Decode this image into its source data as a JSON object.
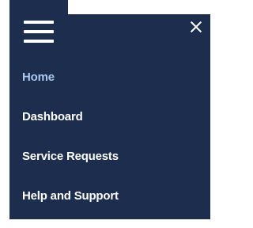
{
  "menu": {
    "background_color": "#1c2d4d",
    "active_color": "#a9c8f0",
    "hamburger_icon": "hamburger-icon",
    "close_icon": "close-icon",
    "items": [
      {
        "label": "Home",
        "active": true
      },
      {
        "label": "Dashboard",
        "active": false
      },
      {
        "label": "Service Requests",
        "active": false
      },
      {
        "label": "Help and Support",
        "active": false
      }
    ]
  }
}
